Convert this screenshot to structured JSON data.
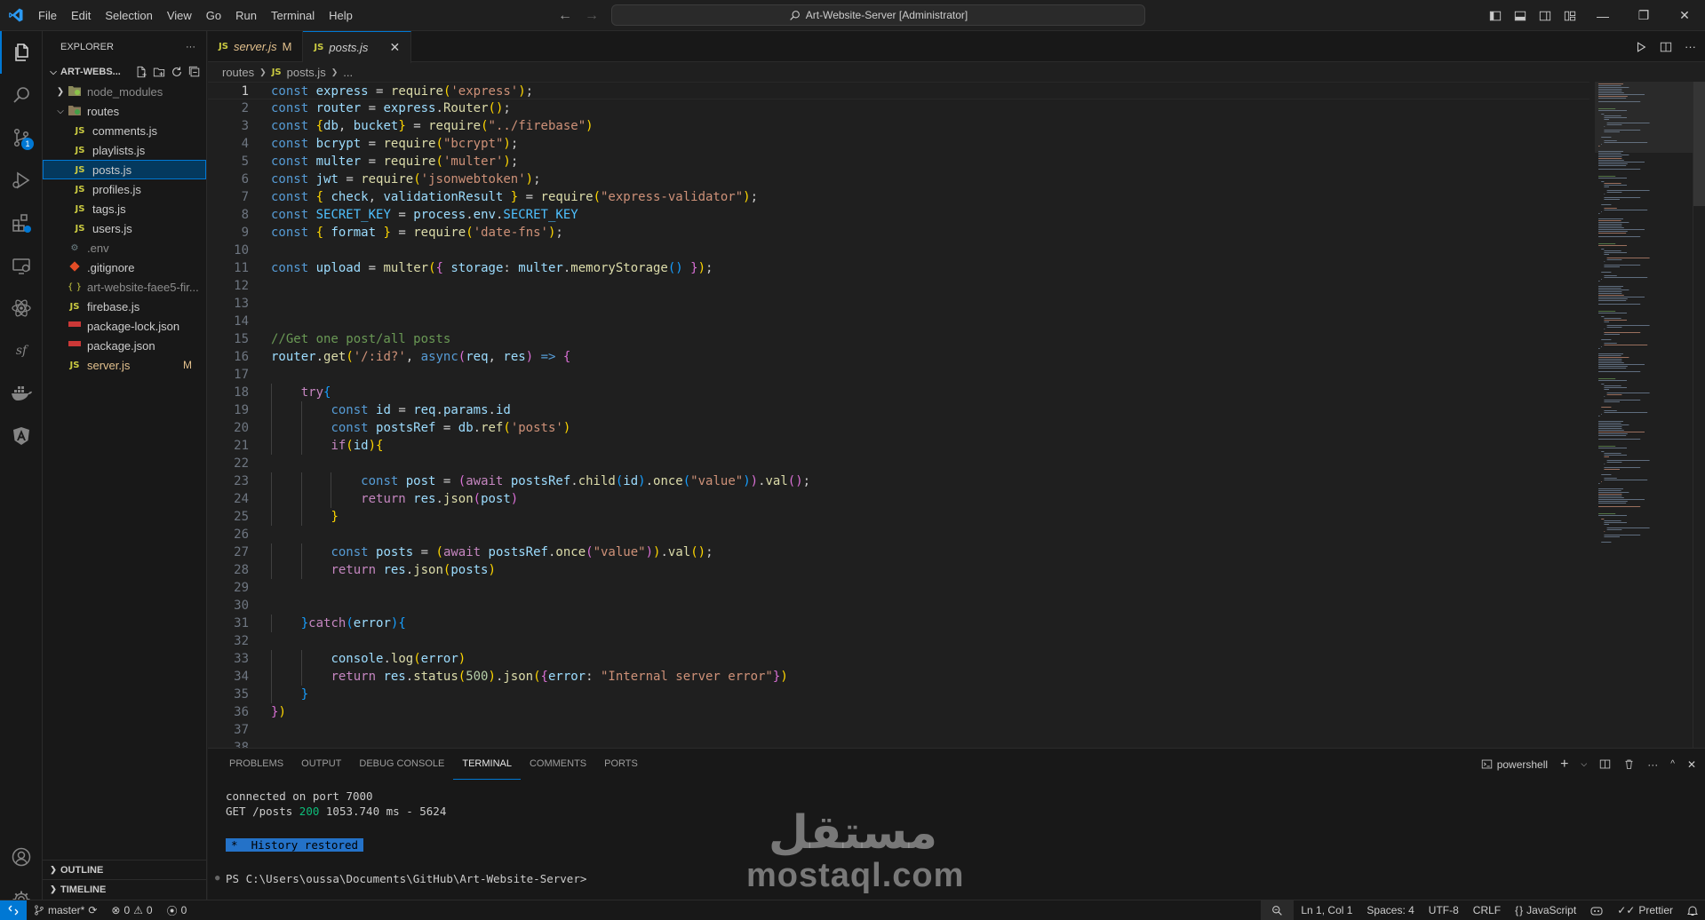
{
  "titlebar": {
    "menu": [
      "File",
      "Edit",
      "Selection",
      "View",
      "Go",
      "Run",
      "Terminal",
      "Help"
    ],
    "command_center": "Art-Website-Server [Administrator]"
  },
  "activitybar": {
    "source_control_badge": "1"
  },
  "sidebar": {
    "title": "EXPLORER",
    "more": "···",
    "root": "ART-WEBS...",
    "items": [
      {
        "name": "node_modules",
        "type": "folder",
        "depth": 0,
        "collapsed": true
      },
      {
        "name": "routes",
        "type": "folder",
        "depth": 0,
        "collapsed": false
      },
      {
        "name": "comments.js",
        "type": "js",
        "depth": 1
      },
      {
        "name": "playlists.js",
        "type": "js",
        "depth": 1
      },
      {
        "name": "posts.js",
        "type": "js",
        "depth": 1,
        "selected": true
      },
      {
        "name": "profiles.js",
        "type": "js",
        "depth": 1
      },
      {
        "name": "tags.js",
        "type": "js",
        "depth": 1
      },
      {
        "name": "users.js",
        "type": "js",
        "depth": 1
      },
      {
        "name": ".env",
        "type": "env",
        "depth": 0
      },
      {
        "name": ".gitignore",
        "type": "git",
        "depth": 0
      },
      {
        "name": "art-website-faee5-fir...",
        "type": "json-braces",
        "depth": 0
      },
      {
        "name": "firebase.js",
        "type": "js",
        "depth": 0
      },
      {
        "name": "package-lock.json",
        "type": "npm",
        "depth": 0
      },
      {
        "name": "package.json",
        "type": "npm",
        "depth": 0
      },
      {
        "name": "server.js",
        "type": "js",
        "depth": 0,
        "modified": "M"
      }
    ],
    "outline": "OUTLINE",
    "timeline": "TIMELINE"
  },
  "tabs": [
    {
      "name": "server.js",
      "lang": "JS",
      "modified": "M",
      "active": false
    },
    {
      "name": "posts.js",
      "lang": "JS",
      "close": "✕",
      "active": true
    }
  ],
  "breadcrumb": {
    "folder": "routes",
    "lang": "JS",
    "file": "posts.js",
    "more": "..."
  },
  "code_lines": [
    "const express = require('express');",
    "const router = express.Router();",
    "const {db, bucket} = require(\"../firebase\")",
    "const bcrypt = require(\"bcrypt\");",
    "const multer = require('multer');",
    "const jwt = require('jsonwebtoken');",
    "const { check, validationResult } = require(\"express-validator\");",
    "const SECRET_KEY = process.env.SECRET_KEY",
    "const { format } = require('date-fns');",
    "",
    "const upload = multer({ storage: multer.memoryStorage() });",
    "",
    "",
    "",
    "//Get one post/all posts",
    "router.get('/:id?', async(req, res) => {",
    "",
    "    try{",
    "        const id = req.params.id",
    "        const postsRef = db.ref('posts')",
    "        if(id){",
    "",
    "            const post = (await postsRef.child(id).once(\"value\")).val();",
    "            return res.json(post)",
    "        }",
    "",
    "        const posts = (await postsRef.once(\"value\")).val();",
    "        return res.json(posts)",
    "",
    "",
    "    }catch(error){",
    "",
    "        console.log(error)",
    "        return res.status(500).json({error: \"Internal server error\"})",
    "    }",
    "})",
    "",
    ""
  ],
  "panel": {
    "tabs": [
      "PROBLEMS",
      "OUTPUT",
      "DEBUG CONSOLE",
      "TERMINAL",
      "COMMENTS",
      "PORTS"
    ],
    "active_tab": "TERMINAL",
    "shell": "powershell",
    "terminal": {
      "line1": "connected on port 7000",
      "line2_prefix": "GET /posts ",
      "line2_status": "200",
      "line2_suffix": " 1053.740 ms - 5624",
      "history_star": "*",
      "history": "History restored",
      "prompt": "PS C:\\Users\\oussa\\Documents\\GitHub\\Art-Website-Server>"
    }
  },
  "statusbar": {
    "branch": "master*",
    "errors": "0",
    "warnings": "0",
    "ports": "0",
    "position": "Ln 1, Col 1",
    "spaces": "Spaces: 4",
    "encoding": "UTF-8",
    "eol": "CRLF",
    "language": "JavaScript",
    "prettier": "Prettier"
  },
  "watermark": {
    "arabic": "مستقل",
    "latin": "mostaql.com"
  },
  "colors": {
    "accent": "#0078d4",
    "background": "#1f1f1f",
    "sidebar": "#181818",
    "keyword": "#569cd6",
    "string": "#ce9178",
    "comment": "#6a9955",
    "function": "#dcdcaa",
    "variable": "#9cdcfe"
  }
}
